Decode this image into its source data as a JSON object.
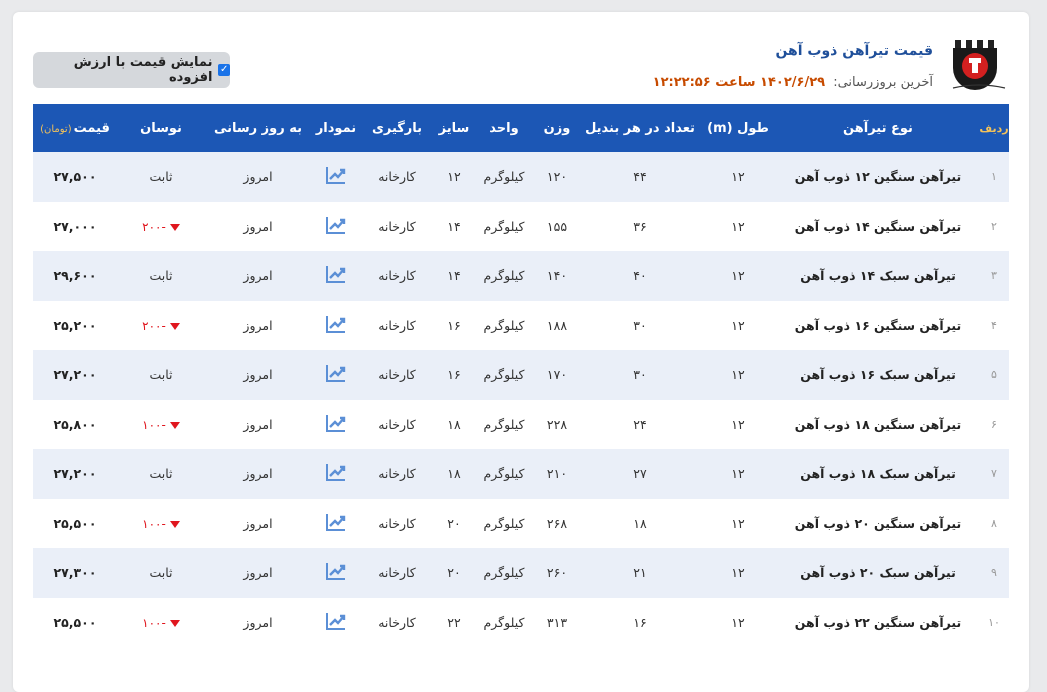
{
  "header": {
    "title": "قیمت تیرآهن ذوب آهن",
    "updated_label": "آخرین بروزرسانی:",
    "updated_value": "۱۴۰۲/۶/۲۹ ساعت ۱۲:۲۲:۵۶",
    "vat_toggle_label": "نمایش قیمت با ارزش افزوده",
    "vat_checked": true
  },
  "colors": {
    "header_bg": "#1c57b5",
    "accent_gold": "#f1c15a",
    "down_red": "#e0161e"
  },
  "table": {
    "columns": {
      "row": "ردیف",
      "type": "نوع تیرآهن",
      "length": "طول (m)",
      "per_bundle": "تعداد در هر بندیل",
      "weight": "وزن",
      "unit": "واحد",
      "size": "سایز",
      "loading": "بارگیری",
      "chart": "نمودار",
      "updated": "به روز رسانی",
      "change": "نوسان",
      "price": "قیمت",
      "price_unit": "(تومان)"
    },
    "rows": [
      {
        "row": "۱",
        "type": "تیرآهن سنگین ۱۲ ذوب آهن",
        "length": "۱۲",
        "per_bundle": "۴۴",
        "weight": "۱۲۰",
        "unit": "کیلوگرم",
        "size": "۱۲",
        "loading": "کارخانه",
        "updated": "امروز",
        "change": "ثابت",
        "change_down": false,
        "price": "۲۷,۵۰۰"
      },
      {
        "row": "۲",
        "type": "تیرآهن سنگین ۱۴ ذوب آهن",
        "length": "۱۲",
        "per_bundle": "۳۶",
        "weight": "۱۵۵",
        "unit": "کیلوگرم",
        "size": "۱۴",
        "loading": "کارخانه",
        "updated": "امروز",
        "change": "-۲۰۰",
        "change_down": true,
        "price": "۲۷,۰۰۰"
      },
      {
        "row": "۳",
        "type": "تیرآهن سبک ۱۴ ذوب آهن",
        "length": "۱۲",
        "per_bundle": "۴۰",
        "weight": "۱۴۰",
        "unit": "کیلوگرم",
        "size": "۱۴",
        "loading": "کارخانه",
        "updated": "امروز",
        "change": "ثابت",
        "change_down": false,
        "price": "۲۹,۶۰۰"
      },
      {
        "row": "۴",
        "type": "تیرآهن سنگین ۱۶ ذوب آهن",
        "length": "۱۲",
        "per_bundle": "۳۰",
        "weight": "۱۸۸",
        "unit": "کیلوگرم",
        "size": "۱۶",
        "loading": "کارخانه",
        "updated": "امروز",
        "change": "-۲۰۰",
        "change_down": true,
        "price": "۲۵,۲۰۰"
      },
      {
        "row": "۵",
        "type": "تیرآهن سبک ۱۶ ذوب آهن",
        "length": "۱۲",
        "per_bundle": "۳۰",
        "weight": "۱۷۰",
        "unit": "کیلوگرم",
        "size": "۱۶",
        "loading": "کارخانه",
        "updated": "امروز",
        "change": "ثابت",
        "change_down": false,
        "price": "۲۷,۲۰۰"
      },
      {
        "row": "۶",
        "type": "تیرآهن سنگین ۱۸ ذوب آهن",
        "length": "۱۲",
        "per_bundle": "۲۴",
        "weight": "۲۲۸",
        "unit": "کیلوگرم",
        "size": "۱۸",
        "loading": "کارخانه",
        "updated": "امروز",
        "change": "-۱۰۰",
        "change_down": true,
        "price": "۲۵,۸۰۰"
      },
      {
        "row": "۷",
        "type": "تیرآهن سبک ۱۸ ذوب آهن",
        "length": "۱۲",
        "per_bundle": "۲۷",
        "weight": "۲۱۰",
        "unit": "کیلوگرم",
        "size": "۱۸",
        "loading": "کارخانه",
        "updated": "امروز",
        "change": "ثابت",
        "change_down": false,
        "price": "۲۷,۲۰۰"
      },
      {
        "row": "۸",
        "type": "تیرآهن سنگین ۲۰ ذوب آهن",
        "length": "۱۲",
        "per_bundle": "۱۸",
        "weight": "۲۶۸",
        "unit": "کیلوگرم",
        "size": "۲۰",
        "loading": "کارخانه",
        "updated": "امروز",
        "change": "-۱۰۰",
        "change_down": true,
        "price": "۲۵,۵۰۰"
      },
      {
        "row": "۹",
        "type": "تیرآهن سبک ۲۰ ذوب آهن",
        "length": "۱۲",
        "per_bundle": "۲۱",
        "weight": "۲۶۰",
        "unit": "کیلوگرم",
        "size": "۲۰",
        "loading": "کارخانه",
        "updated": "امروز",
        "change": "ثابت",
        "change_down": false,
        "price": "۲۷,۳۰۰"
      },
      {
        "row": "۱۰",
        "type": "تیرآهن سنگین ۲۲ ذوب آهن",
        "length": "۱۲",
        "per_bundle": "۱۶",
        "weight": "۳۱۳",
        "unit": "کیلوگرم",
        "size": "۲۲",
        "loading": "کارخانه",
        "updated": "امروز",
        "change": "-۱۰۰",
        "change_down": true,
        "price": "۲۵,۵۰۰"
      }
    ]
  }
}
